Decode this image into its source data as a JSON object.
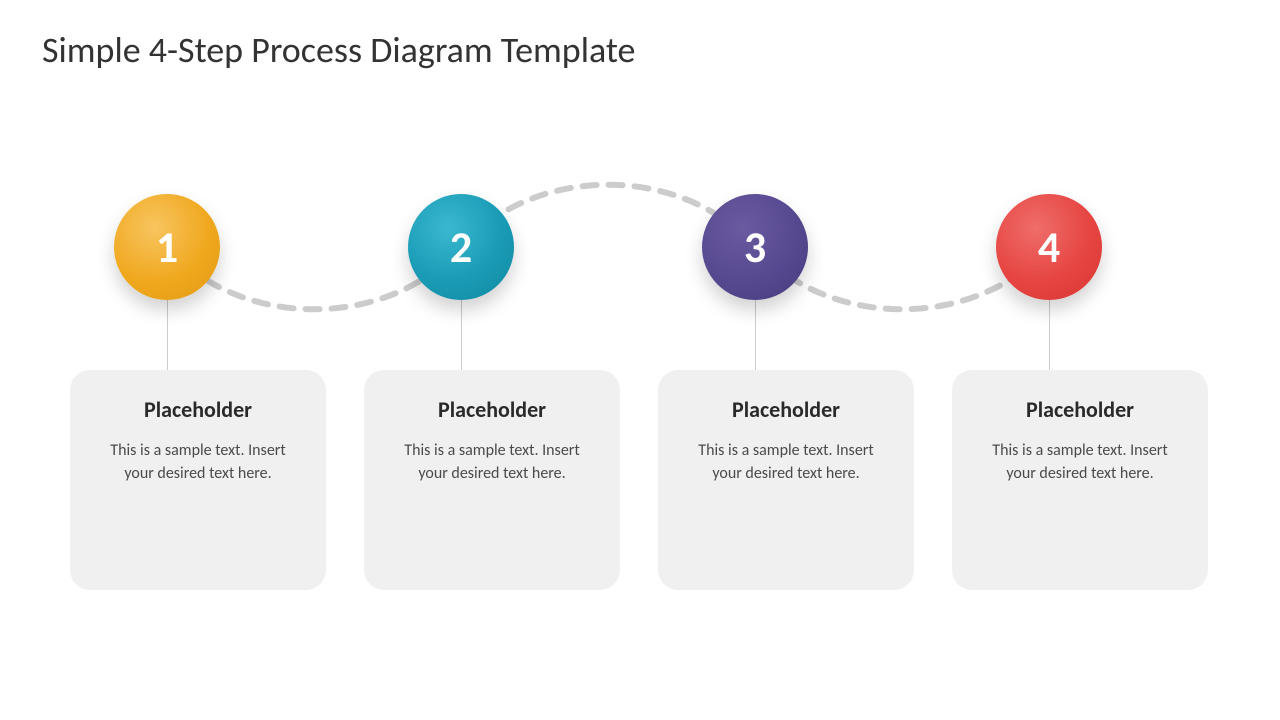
{
  "title": "Simple 4-Step Process Diagram Template",
  "steps": [
    {
      "number": "1",
      "heading": "Placeholder",
      "text": "This is a sample text. Insert your desired text here.",
      "color": "#f0a81f"
    },
    {
      "number": "2",
      "heading": "Placeholder",
      "text": "This is a sample text. Insert your desired text here.",
      "color": "#1a9bb5"
    },
    {
      "number": "3",
      "heading": "Placeholder",
      "text": "This is a sample text. Insert your desired text here.",
      "color": "#574990"
    },
    {
      "number": "4",
      "heading": "Placeholder",
      "text": "This is a sample text. Insert your desired text here.",
      "color": "#e64542"
    }
  ]
}
